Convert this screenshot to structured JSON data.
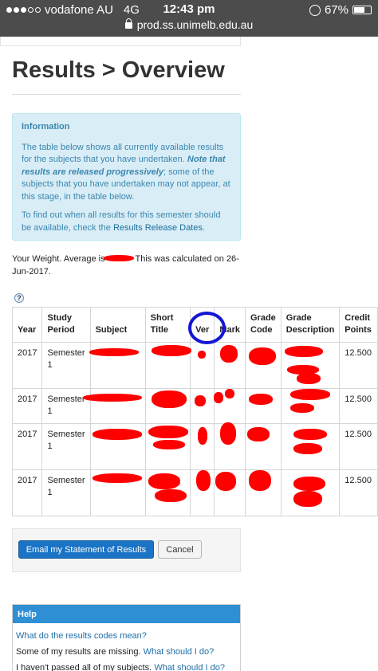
{
  "status_bar": {
    "carrier": "vodafone AU",
    "network": "4G",
    "time": "12:43 pm",
    "battery_text": "67%",
    "battery_level": 0.67,
    "url": "prod.ss.unimelb.edu.au"
  },
  "page": {
    "title": "Results > Overview"
  },
  "info": {
    "heading": "Information",
    "line1": "The table below shows all currently available results for the subjects that you have undertaken.",
    "note": "Note that results are released progressively",
    "line2": "; some of the subjects that you have undertaken may not appear, at this stage, in the table below.",
    "line3": "To find out when all results for this semester should be available, check the ",
    "link": "Results Release Dates",
    "line3_end": "."
  },
  "weight": {
    "prefix": "Your Weight. Average is",
    "suffix": "This was calculated on 26-Jun-2017."
  },
  "help_icon": "?",
  "table": {
    "headers": {
      "year": "Year",
      "period": "Study Period",
      "subject": "Subject",
      "short": "Short Title",
      "ver": "Ver",
      "mark": "Mark",
      "code": "Grade Code",
      "desc": "Grade Description",
      "credit": "Credit Points"
    },
    "rows": [
      {
        "year": "2017",
        "period": "Semester 1",
        "credit": "12.500"
      },
      {
        "year": "2017",
        "period": "Semester 1",
        "credit": "12.500"
      },
      {
        "year": "2017",
        "period": "Semester 1",
        "credit": "12.500"
      },
      {
        "year": "2017",
        "period": "Semester 1",
        "credit": "12.500"
      }
    ]
  },
  "actions": {
    "email_label": "Email my Statement of Results",
    "cancel_label": "Cancel"
  },
  "help": {
    "heading": "Help",
    "q1": "What do the results codes mean?",
    "q2_text": "Some of my results are missing.",
    "q2_link": "What should I do?",
    "q3_text": "I haven't passed all of my subjects.",
    "q3_link": "What should I do?"
  },
  "colors": {
    "status_bar": "#4c4c4c",
    "info_bg": "#d9edf7",
    "primary_button": "#1a73c4",
    "help_header": "#2f8fd4",
    "redaction": "#ff0000",
    "annotation_circle": "#1515d6"
  }
}
